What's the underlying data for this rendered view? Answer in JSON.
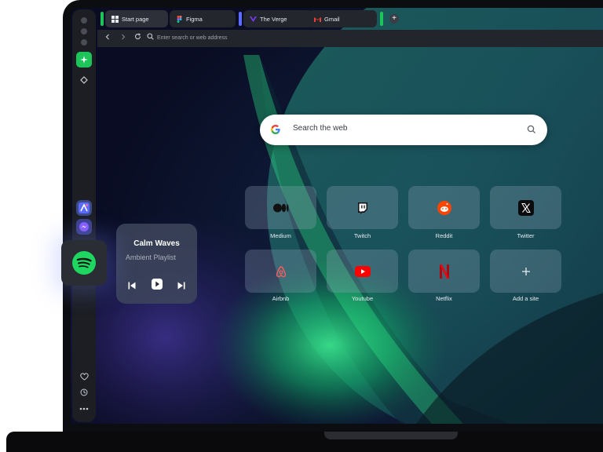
{
  "tabs": [
    {
      "label": "Start page",
      "icon": "grid-icon",
      "active": true
    },
    {
      "label": "Figma",
      "icon": "figma-icon"
    },
    {
      "label": "The Verge",
      "icon": "verge-icon"
    },
    {
      "label": "Gmail",
      "icon": "gmail-icon"
    }
  ],
  "addressbar": {
    "placeholder": "Enter search or web address"
  },
  "search": {
    "placeholder": "Search the web"
  },
  "speed_dial": [
    {
      "label": "Medium",
      "icon": "medium-icon"
    },
    {
      "label": "Twitch",
      "icon": "twitch-icon"
    },
    {
      "label": "Reddit",
      "icon": "reddit-icon"
    },
    {
      "label": "Twitter",
      "icon": "x-icon"
    },
    {
      "label": "Airbnb",
      "icon": "airbnb-icon"
    },
    {
      "label": "Youtube",
      "icon": "youtube-icon"
    },
    {
      "label": "Netflix",
      "icon": "netflix-icon"
    },
    {
      "label": "Add a site",
      "icon": "plus-icon"
    }
  ],
  "music": {
    "title": "Calm Waves",
    "subtitle": "Ambient Playlist"
  },
  "colors": {
    "accent": "#1cc45a",
    "spotify": "#1ed760",
    "twitch": "#9146ff",
    "reddit": "#ff4500",
    "youtube": "#ff0000",
    "netflix": "#e50914",
    "airbnb": "#ff5a5f"
  }
}
